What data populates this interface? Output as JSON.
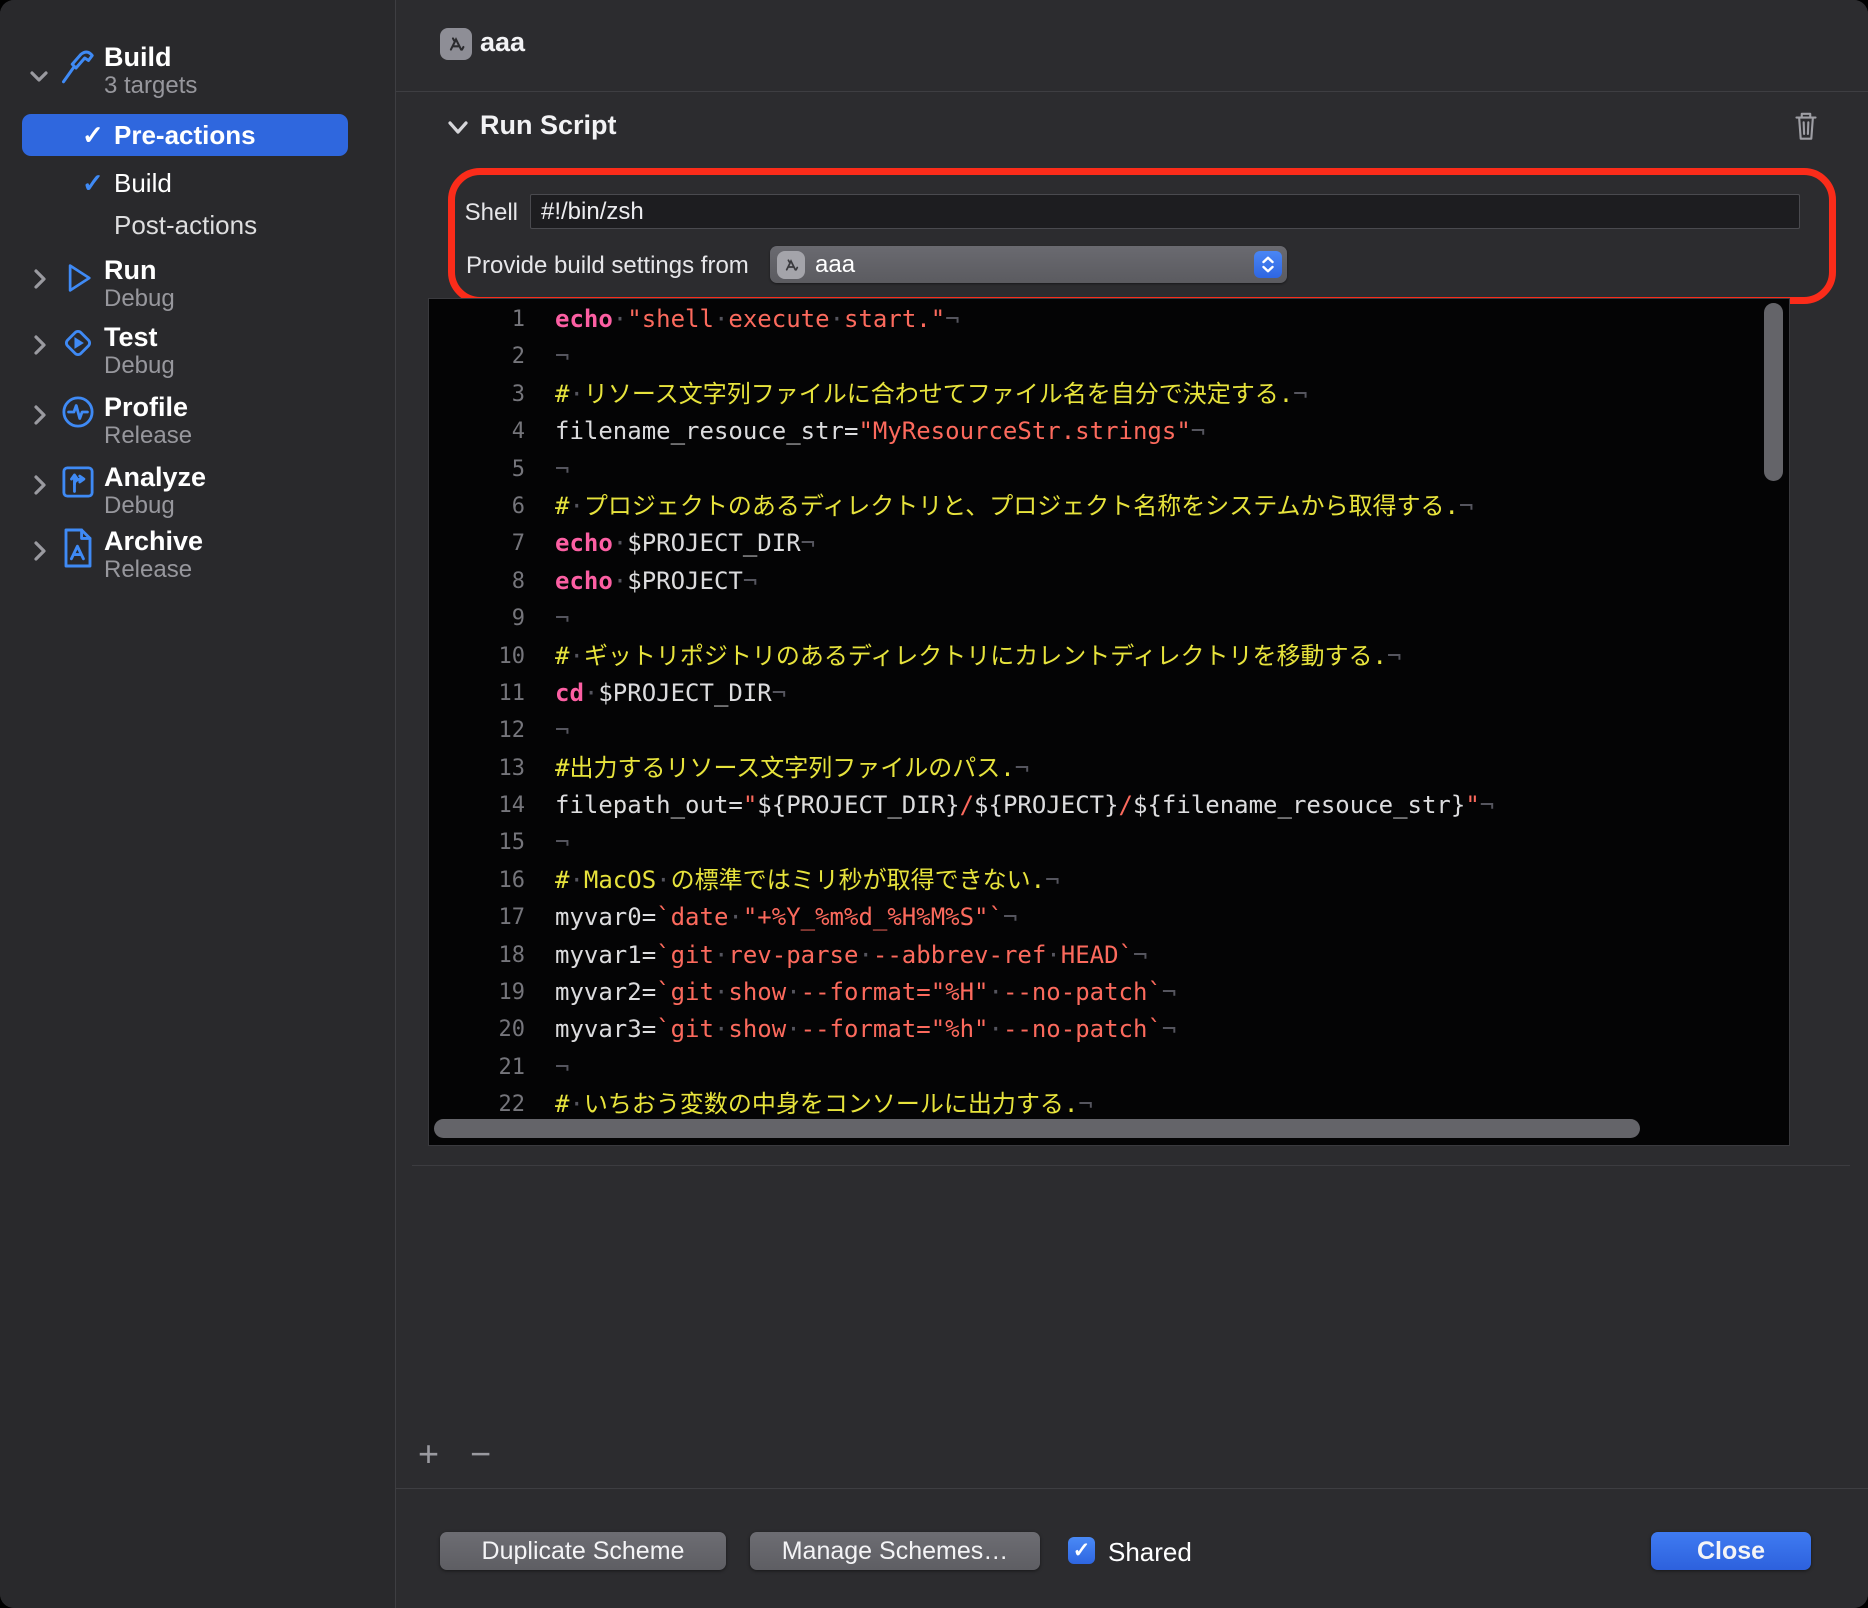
{
  "header": {
    "title": "aaa"
  },
  "sidebar": {
    "items": [
      {
        "title": "Build",
        "subtitle": "3 targets",
        "icon": "hammer",
        "expanded": true,
        "children": [
          {
            "label": "Pre-actions",
            "checked": true,
            "selected": true
          },
          {
            "label": "Build",
            "checked": true,
            "selected": false
          },
          {
            "label": "Post-actions",
            "checked": false,
            "selected": false
          }
        ]
      },
      {
        "title": "Run",
        "subtitle": "Debug",
        "icon": "play"
      },
      {
        "title": "Test",
        "subtitle": "Debug",
        "icon": "diamond-play"
      },
      {
        "title": "Profile",
        "subtitle": "Release",
        "icon": "pulse-circle"
      },
      {
        "title": "Analyze",
        "subtitle": "Debug",
        "icon": "branch-square"
      },
      {
        "title": "Archive",
        "subtitle": "Release",
        "icon": "document-a"
      }
    ]
  },
  "run_script": {
    "section_title": "Run Script",
    "shell_label": "Shell",
    "shell_value": "#!/bin/zsh",
    "provide_label": "Provide build settings from",
    "provide_value": "aaa"
  },
  "editor": {
    "lines": [
      {
        "n": 1,
        "s": [
          [
            "kw",
            "echo"
          ],
          [
            "inv",
            "·"
          ],
          [
            "str",
            "\"shell"
          ],
          [
            "inv",
            "·"
          ],
          [
            "str",
            "execute"
          ],
          [
            "inv",
            "·"
          ],
          [
            "str",
            "start.\""
          ],
          [
            "inv",
            "¬"
          ]
        ]
      },
      {
        "n": 2,
        "s": [
          [
            "inv",
            "¬"
          ]
        ]
      },
      {
        "n": 3,
        "s": [
          [
            "cmt",
            "#"
          ],
          [
            "inv",
            "·"
          ],
          [
            "cmt",
            "リソース文字列ファイルに合わせてファイル名を自分で決定する."
          ],
          [
            "inv",
            "¬"
          ]
        ]
      },
      {
        "n": 4,
        "s": [
          [
            "pln",
            "filename_resouce_str="
          ],
          [
            "str",
            "\"MyResourceStr.strings\""
          ],
          [
            "inv",
            "¬"
          ]
        ]
      },
      {
        "n": 5,
        "s": [
          [
            "inv",
            "¬"
          ]
        ]
      },
      {
        "n": 6,
        "s": [
          [
            "cmt",
            "#"
          ],
          [
            "inv",
            "·"
          ],
          [
            "cmt",
            "プロジェクトのあるディレクトリと、プロジェクト名称をシステムから取得する."
          ],
          [
            "inv",
            "¬"
          ]
        ]
      },
      {
        "n": 7,
        "s": [
          [
            "kw",
            "echo"
          ],
          [
            "inv",
            "·"
          ],
          [
            "pln",
            "$PROJECT_DIR"
          ],
          [
            "inv",
            "¬"
          ]
        ]
      },
      {
        "n": 8,
        "s": [
          [
            "kw",
            "echo"
          ],
          [
            "inv",
            "·"
          ],
          [
            "pln",
            "$PROJECT"
          ],
          [
            "inv",
            "¬"
          ]
        ]
      },
      {
        "n": 9,
        "s": [
          [
            "inv",
            "¬"
          ]
        ]
      },
      {
        "n": 10,
        "s": [
          [
            "cmt",
            "#"
          ],
          [
            "inv",
            "·"
          ],
          [
            "cmt",
            "ギットリポジトリのあるディレクトリにカレントディレクトリを移動する."
          ],
          [
            "inv",
            "¬"
          ]
        ]
      },
      {
        "n": 11,
        "s": [
          [
            "kw",
            "cd"
          ],
          [
            "inv",
            "·"
          ],
          [
            "pln",
            "$PROJECT_DIR"
          ],
          [
            "inv",
            "¬"
          ]
        ]
      },
      {
        "n": 12,
        "s": [
          [
            "inv",
            "¬"
          ]
        ]
      },
      {
        "n": 13,
        "s": [
          [
            "cmt",
            "#出力するリソース文字列ファイルのパス."
          ],
          [
            "inv",
            "¬"
          ]
        ]
      },
      {
        "n": 14,
        "s": [
          [
            "pln",
            "filepath_out="
          ],
          [
            "str",
            "\""
          ],
          [
            "pln",
            "${PROJECT_DIR}"
          ],
          [
            "str",
            "/"
          ],
          [
            "pln",
            "${PROJECT}"
          ],
          [
            "str",
            "/"
          ],
          [
            "pln",
            "${filename_resouce_str}"
          ],
          [
            "str",
            "\""
          ],
          [
            "inv",
            "¬"
          ]
        ]
      },
      {
        "n": 15,
        "s": [
          [
            "inv",
            "¬"
          ]
        ]
      },
      {
        "n": 16,
        "s": [
          [
            "cmt",
            "#"
          ],
          [
            "inv",
            "·"
          ],
          [
            "cmt",
            "MacOS"
          ],
          [
            "inv",
            "·"
          ],
          [
            "cmt",
            "の標準ではミリ秒が取得できない."
          ],
          [
            "inv",
            "¬"
          ]
        ]
      },
      {
        "n": 17,
        "s": [
          [
            "pln",
            "myvar0="
          ],
          [
            "str",
            "`date"
          ],
          [
            "inv",
            "·"
          ],
          [
            "str",
            "\"+%Y_%m%d_%H%M%S\"`"
          ],
          [
            "inv",
            "¬"
          ]
        ]
      },
      {
        "n": 18,
        "s": [
          [
            "pln",
            "myvar1="
          ],
          [
            "str",
            "`git"
          ],
          [
            "inv",
            "·"
          ],
          [
            "str",
            "rev-parse"
          ],
          [
            "inv",
            "·"
          ],
          [
            "str",
            "--abbrev-ref"
          ],
          [
            "inv",
            "·"
          ],
          [
            "str",
            "HEAD`"
          ],
          [
            "inv",
            "¬"
          ]
        ]
      },
      {
        "n": 19,
        "s": [
          [
            "pln",
            "myvar2="
          ],
          [
            "str",
            "`git"
          ],
          [
            "inv",
            "·"
          ],
          [
            "str",
            "show"
          ],
          [
            "inv",
            "·"
          ],
          [
            "str",
            "--format=\"%H\""
          ],
          [
            "inv",
            "·"
          ],
          [
            "str",
            "--no-patch`"
          ],
          [
            "inv",
            "¬"
          ]
        ]
      },
      {
        "n": 20,
        "s": [
          [
            "pln",
            "myvar3="
          ],
          [
            "str",
            "`git"
          ],
          [
            "inv",
            "·"
          ],
          [
            "str",
            "show"
          ],
          [
            "inv",
            "·"
          ],
          [
            "str",
            "--format=\"%h\""
          ],
          [
            "inv",
            "·"
          ],
          [
            "str",
            "--no-patch`"
          ],
          [
            "inv",
            "¬"
          ]
        ]
      },
      {
        "n": 21,
        "s": [
          [
            "inv",
            "¬"
          ]
        ]
      },
      {
        "n": 22,
        "s": [
          [
            "cmt",
            "#"
          ],
          [
            "inv",
            "·"
          ],
          [
            "cmt",
            "いちおう変数の中身をコンソールに出力する."
          ],
          [
            "inv",
            "¬"
          ]
        ]
      }
    ]
  },
  "footer": {
    "duplicate_label": "Duplicate Scheme",
    "manage_label": "Manage Schemes…",
    "shared_label": "Shared",
    "shared_checked": true,
    "close_label": "Close"
  },
  "glyphs": {
    "check": "✓",
    "plus": "+",
    "minus": "−"
  },
  "colors": {
    "accent_blue": "#3f8af5",
    "selection_blue": "#2f67de",
    "annotation_red": "#fb2c1a",
    "syntax_keyword": "#fc5fa3",
    "syntax_string": "#fc6a5d",
    "syntax_comment": "#e7e33c",
    "syntax_plain": "#dcdcde",
    "syntax_invisible": "#55555e",
    "editor_bg": "#040405"
  }
}
